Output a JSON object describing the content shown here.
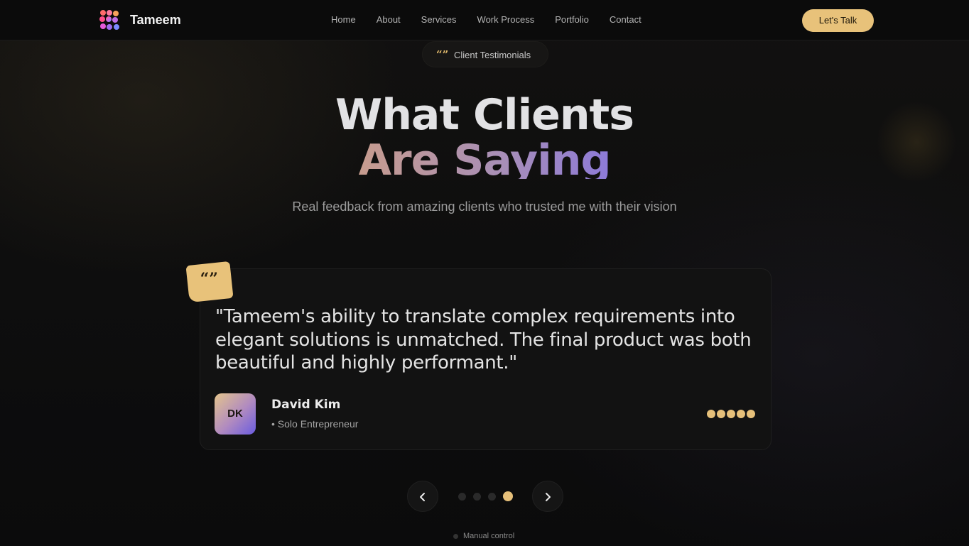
{
  "nav": {
    "brand": "Tameem",
    "menu": [
      "Home",
      "About",
      "Services",
      "Work Process",
      "Portfolio",
      "Contact"
    ],
    "cta": "Let's Talk"
  },
  "hero": {
    "badge_text": "Client Testimonials",
    "title_line1": "What Clients",
    "title_line2": "Are Saying",
    "subtitle": "Real feedback from amazing clients who trusted me with their vision"
  },
  "testimonial": {
    "quote": "\"Tameem's ability to translate complex requirements into elegant solutions is unmatched. The final product was both beautiful and highly performant.\"",
    "initials": "DK",
    "name": "David Kim",
    "role": "• Solo Entrepreneur",
    "rating": 5
  },
  "carousel": {
    "total_slides": 4,
    "active_slide": 4,
    "status": "Manual control"
  },
  "colors": {
    "accent": "#e8c27a",
    "background": "#0d0d0d"
  },
  "icons": {
    "quote": "quote-icon",
    "prev": "chevron-left-icon",
    "next": "chevron-right-icon"
  }
}
